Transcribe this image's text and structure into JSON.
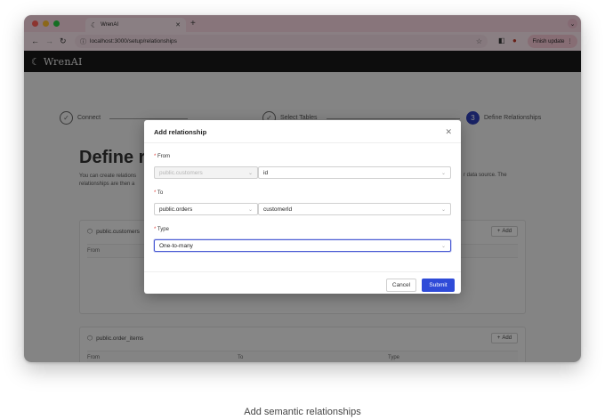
{
  "browser": {
    "tab_title": "WrenAI",
    "url": "localhost:3000/setup/relationships",
    "finish_update": "Finish update"
  },
  "app": {
    "brand": "WrenAI"
  },
  "steps": [
    {
      "num": "",
      "label": "Connect"
    },
    {
      "num": "",
      "label": "Select Tables"
    },
    {
      "num": "3",
      "label": "Define Relationships"
    }
  ],
  "page": {
    "title": "Define re",
    "desc_line1": "You can create relations",
    "desc_line2": "relationships are then a",
    "desc_right": "r data source. The"
  },
  "cards": [
    {
      "model": "public.customers",
      "add": "Add",
      "columns": [
        "From"
      ]
    },
    {
      "model": "public.order_items",
      "add": "Add",
      "columns": [
        "From",
        "To",
        "Type"
      ]
    }
  ],
  "modal": {
    "title": "Add relationship",
    "from_label": "From",
    "from_model": "public.customers",
    "from_field": "id",
    "to_label": "To",
    "to_model": "public.orders",
    "to_field": "customerId",
    "type_label": "Type",
    "type_value": "One-to-many",
    "cancel": "Cancel",
    "submit": "Submit"
  },
  "caption": "Add semantic relationships"
}
